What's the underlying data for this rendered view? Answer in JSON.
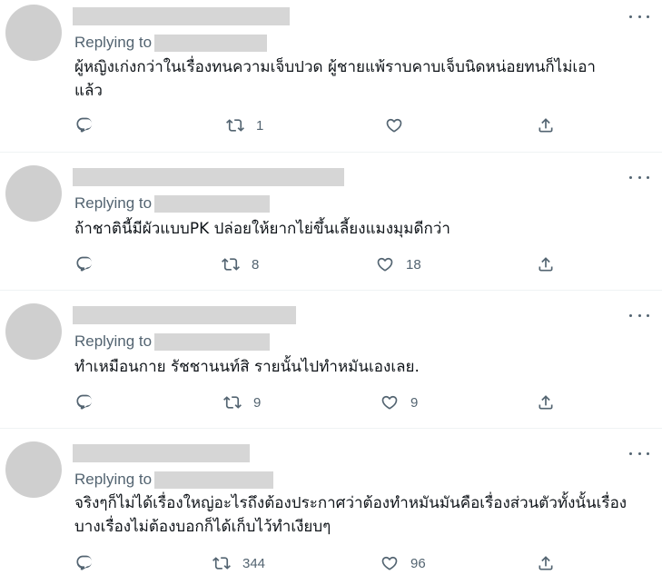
{
  "replies": [
    {
      "replying_to": "Replying to",
      "text": "ผู้หญิงเก่งกว่าในเรื่องทนความเจ็บปวด ผู้ชายแพ้ราบคาบเจ็บนิดหน่อยทนก็ไม่เอา\nแล้ว",
      "retweets": "1",
      "likes": ""
    },
    {
      "replying_to": "Replying to",
      "text": "ถ้าชาตินี้มีผัวแบบPK ปล่อยให้ยากไย่ขึ้นเลี้ยงแมงมุมดีกว่า",
      "retweets": "8",
      "likes": "18"
    },
    {
      "replying_to": "Replying to",
      "text": "ทำเหมือนกาย รัชชานนท์สิ รายนั้นไปทำหมันเองเลย.",
      "retweets": "9",
      "likes": "9"
    },
    {
      "replying_to": "Replying to",
      "text": "จริงๆก็ไม่ได้เรื่องใหญ่อะไรถึงต้องประกาศว่าต้องทำหมันมันคือเรื่องส่วนตัวทั้งนั้นเรื่อง\nบางเรื่องไม่ต้องบอกก็ได้เก็บไว้ทำเงียบๆ",
      "retweets": "344",
      "likes": "96"
    }
  ],
  "icons": {
    "reply": "reply-icon",
    "retweet": "retweet-icon",
    "like": "heart-icon",
    "share": "share-icon",
    "more": "more-icon"
  },
  "colors": {
    "icon": "#536471",
    "text": "#0f1419",
    "redaction": "#d6d6d6",
    "avatar": "#cfcfcf"
  }
}
